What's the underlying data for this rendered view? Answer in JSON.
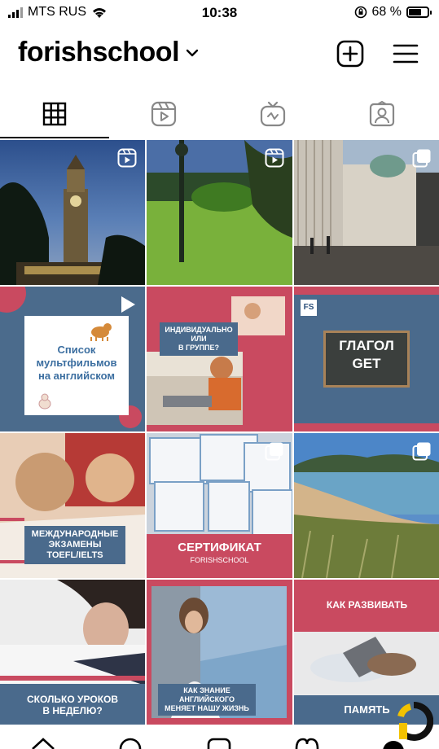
{
  "status": {
    "carrier": "MTS RUS",
    "time": "10:38",
    "battery": "68 %",
    "battery_level": 0.68
  },
  "profile": {
    "username": "forishschool"
  },
  "tabs": [
    {
      "name": "grid",
      "active": true
    },
    {
      "name": "reels",
      "active": false
    },
    {
      "name": "igtv",
      "active": false
    },
    {
      "name": "tagged",
      "active": false
    }
  ],
  "posts": {
    "p4": {
      "line1": "Список",
      "line2": "мультфильмов",
      "line3": "на английском"
    },
    "p5": {
      "line1": "ИНДИВИДУАЛЬНО",
      "line2": "ИЛИ",
      "line3": "В ГРУППЕ?"
    },
    "p6": {
      "logo": "FS",
      "line1": "ГЛАГОЛ",
      "line2": "GET"
    },
    "p7": {
      "line1": "МЕЖДУНАРОДНЫЕ",
      "line2": "ЭКЗАМЕНЫ",
      "line3": "TOEFL/IELTS"
    },
    "p8": {
      "line1": "СЕРТИФИКАТ",
      "line2": "FORISHSCHOOL"
    },
    "p10": {
      "line1": "СКОЛЬКО УРОКОВ",
      "line2": "В НЕДЕЛЮ?"
    },
    "p11": {
      "line1": "КАК ЗНАНИЕ",
      "line2": "АНГЛИЙСКОГО",
      "line3": "МЕНЯЕТ НАШУ ЖИЗНЬ"
    },
    "p12": {
      "line1": "КАК РАЗВИВАТЬ",
      "line2": "ПАМЯТЬ"
    }
  },
  "colors": {
    "brand_red": "#c94a60",
    "brand_blue": "#4a6a8c"
  }
}
